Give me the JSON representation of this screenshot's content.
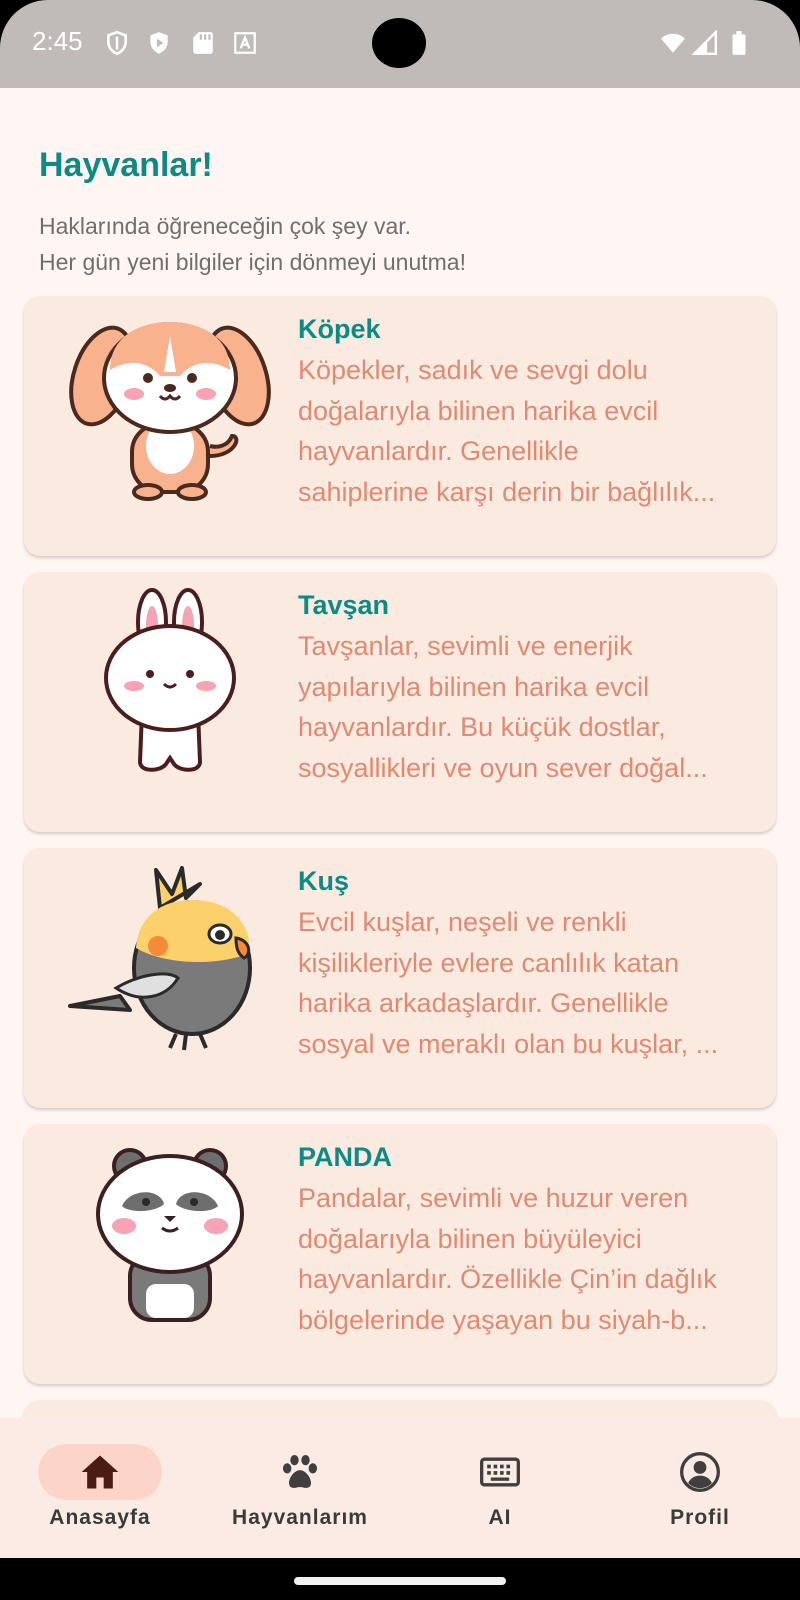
{
  "status_bar": {
    "time": "2:45",
    "left_icons": [
      "shield-icon",
      "play-protect-icon",
      "sd-card-icon",
      "font-a-icon"
    ],
    "right_icons": [
      "wifi-icon",
      "signal-icon",
      "battery-icon"
    ]
  },
  "header": {
    "title": "Hayvanlar!",
    "subtitle": "Haklarında öğreneceğin çok şey var.\nHer gün yeni bilgiler için dönmeyi unutma!"
  },
  "animals": [
    {
      "name": "Köpek",
      "image": "puppy-illustration",
      "desc_lines": [
        "Köpekler, sadık ve sevgi dolu",
        "doğalarıyla bilinen harika evcil",
        "hayvanlardır. Genellikle",
        "sahiplerine karşı derin bir bağlılık..."
      ]
    },
    {
      "name": "Tavşan",
      "image": "bunny-illustration",
      "desc_lines": [
        "Tavşanlar, sevimli ve enerjik",
        "yapılarıyla bilinen harika evcil",
        "hayvanlardır. Bu küçük dostlar,",
        "sosyallikleri ve oyun sever doğal..."
      ]
    },
    {
      "name": "Kuş",
      "image": "cockatiel-illustration",
      "desc_lines": [
        "Evcil kuşlar, neşeli ve renkli",
        "kişilikleriyle evlere canlılık katan",
        "harika arkadaşlardır. Genellikle",
        "sosyal ve meraklı olan bu kuşlar, ..."
      ]
    },
    {
      "name": "PANDA",
      "image": "panda-illustration",
      "desc_lines": [
        "Pandalar, sevimli ve huzur veren",
        "doğalarıyla bilinen büyüleyici",
        "hayvanlardır. Özellikle Çin’in dağlık",
        "bölgelerinde yaşayan bu siyah-b..."
      ]
    }
  ],
  "bottom_nav": {
    "items": [
      {
        "label": "Anasayfa",
        "icon": "home-icon",
        "active": true
      },
      {
        "label": "Hayvanlarım",
        "icon": "paw-icon",
        "active": false
      },
      {
        "label": "AI",
        "icon": "keyboard-icon",
        "active": false
      },
      {
        "label": "Profil",
        "icon": "account-circle-icon",
        "active": false
      }
    ]
  },
  "colors": {
    "accent": "#0e8a85",
    "description": "#df8a72",
    "card_background": "#fbeae0",
    "page_background": "#fff6f3",
    "nav_background": "#fcebe4",
    "nav_active_pill": "#fdd5c8"
  }
}
